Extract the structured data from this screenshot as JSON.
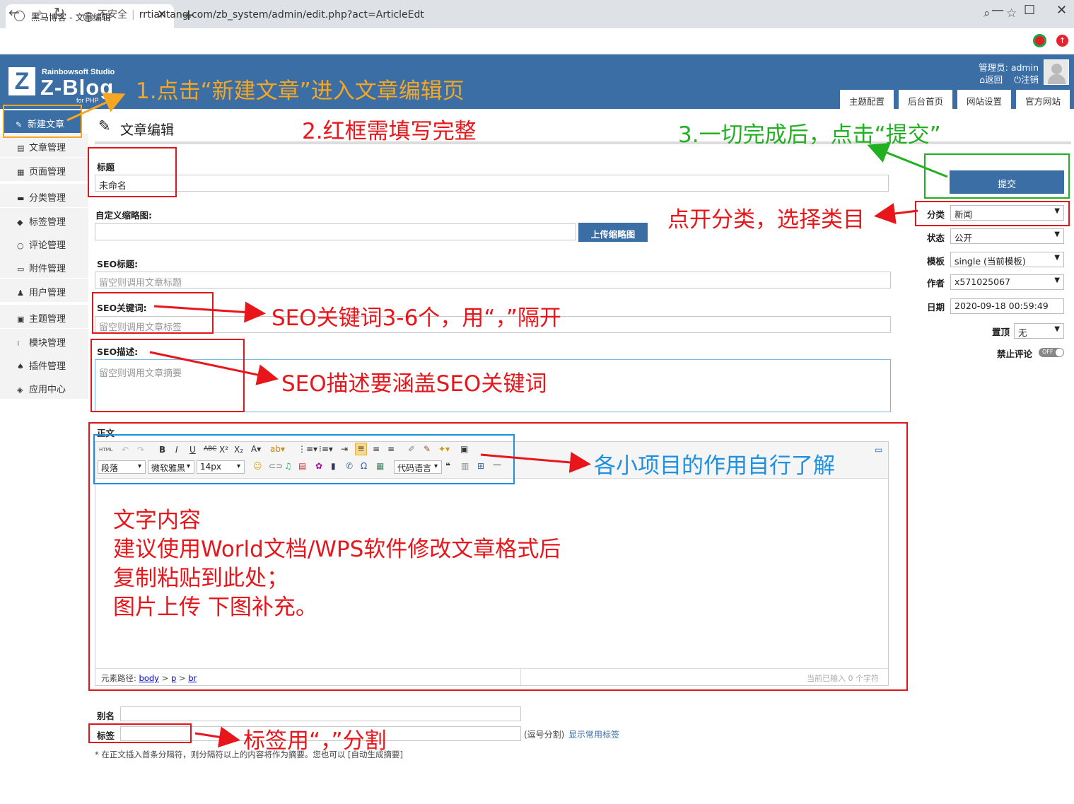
{
  "browser": {
    "tab_title": "黑马博客 - 文章编辑",
    "tab_close": "✕",
    "new_tab": "+",
    "minimize": "—",
    "maximize": "☐",
    "close": "✕",
    "insecure_label": "不安全",
    "url": "rrtiantang.com/zb_system/admin/edit.php?act=ArticleEdt"
  },
  "header": {
    "studio": "Rainbowsoft Studio",
    "logo_text": "Z-Blog",
    "logo_php": "for PHP",
    "admin_label": "管理员: admin",
    "back": "返回",
    "logout": "注销",
    "tabs": [
      "主题配置",
      "后台首页",
      "网站设置",
      "官方网站"
    ]
  },
  "sidebar": {
    "items": [
      {
        "label": "新建文章",
        "icon": "✎"
      },
      {
        "label": "文章管理",
        "icon": "▤"
      },
      {
        "label": "页面管理",
        "icon": "▦"
      },
      {
        "label": "分类管理",
        "icon": "▬"
      },
      {
        "label": "标签管理",
        "icon": "◆"
      },
      {
        "label": "评论管理",
        "icon": "○"
      },
      {
        "label": "附件管理",
        "icon": "▭"
      },
      {
        "label": "用户管理",
        "icon": "♟"
      },
      {
        "label": "主题管理",
        "icon": "▣"
      },
      {
        "label": "模块管理",
        "icon": "⁝"
      },
      {
        "label": "插件管理",
        "icon": "♠"
      },
      {
        "label": "应用中心",
        "icon": "◈"
      }
    ]
  },
  "page": {
    "title": "文章编辑",
    "title_label": "标题",
    "title_value": "未命名",
    "thumb_label": "自定义缩略图:",
    "upload_thumb": "上传缩略图",
    "seo_title_label": "SEO标题:",
    "seo_title_placeholder": "留空则调用文章标题",
    "seo_kw_label": "SEO关键词:",
    "seo_kw_placeholder": "留空则调用文章标签",
    "seo_desc_label": "SEO描述:",
    "seo_desc_placeholder": "留空则调用文章摘要",
    "body_label": "正文",
    "alias_label": "别名",
    "tag_label": "标签",
    "tag_hint": "(逗号分割)",
    "show_tags": "显示常用标签",
    "footnote": "* 在正文插入首条分隔符，则分隔符以上的内容将作为摘要。您也可以 [自动生成摘要]"
  },
  "editor": {
    "html_btn": "HTML",
    "paragraph": "段落",
    "font": "微软雅黑",
    "size": "14px",
    "code_lang": "代码语言",
    "path_label": "元素路径:",
    "path_body": "body",
    "path_p": "p",
    "path_br": "br",
    "char_count": "当前已输入 0 个字符",
    "content_lines": [
      "文字内容",
      "建议使用World文档/WPS软件修改文章格式后",
      "复制粘贴到此处；",
      "图片上传 下图补充。"
    ]
  },
  "side_form": {
    "submit": "提交",
    "category_label": "分类",
    "category_value": "新闻",
    "status_label": "状态",
    "status_value": "公开",
    "template_label": "模板",
    "template_value": "single (当前模板)",
    "author_label": "作者",
    "author_value": "x571025067",
    "date_label": "日期",
    "date_value": "2020-09-18 00:59:49",
    "top_label": "置顶",
    "top_value": "无",
    "disable_comment_label": "禁止评论",
    "toggle_value": "OFF"
  },
  "annotations": {
    "a1": "1.点击“新建文章”进入文章编辑页",
    "a2": "2.红框需填写完整",
    "a3": "3.一切完成后，点击“提交”",
    "category": "点开分类，选择类目",
    "seo_kw": "SEO关键词3-6个，用“，”隔开",
    "seo_desc": "SEO描述要涵盖SEO关键词",
    "toolbar": "各小项目的作用自行了解",
    "tags": "标签用“，”分割"
  },
  "colors": {
    "brand_blue": "#3a6ea5",
    "annot_red": "#e8161b",
    "annot_green": "#22b022",
    "annot_blue": "#1e90e0",
    "annot_orange": "#f5a623"
  }
}
